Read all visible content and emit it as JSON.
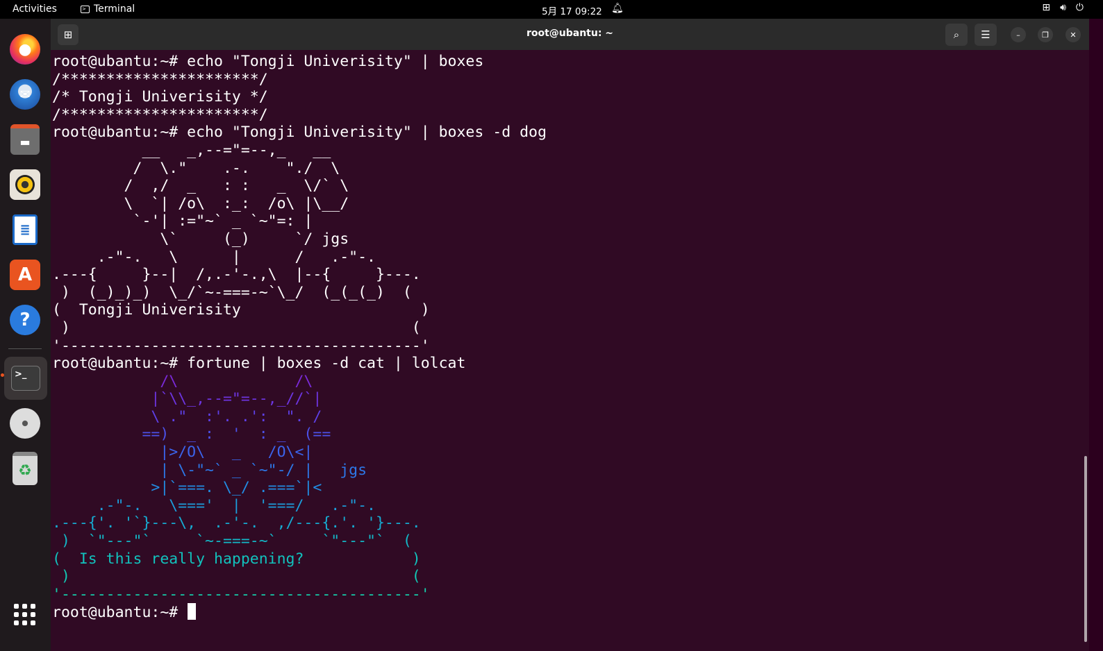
{
  "topbar": {
    "activities": "Activities",
    "app_name": "Terminal",
    "clock": "5月 17  09:22"
  },
  "dock": {
    "items": [
      "firefox-icon",
      "thunderbird-icon",
      "files-icon",
      "rhythmbox-icon",
      "writer-icon",
      "software-icon",
      "help-icon",
      "terminal-icon",
      "disc-icon",
      "trash-icon",
      "show-apps-icon"
    ]
  },
  "window": {
    "title": "root@ubantu: ~"
  },
  "terminal": {
    "lines": [
      "root@ubantu:~# echo \"Tongji Univerisity\" | boxes",
      "/**********************/",
      "/* Tongji Univerisity */",
      "/**********************/",
      "root@ubantu:~# echo \"Tongji Univerisity\" | boxes -d dog",
      "          __   _,--=\"=--,_   __",
      "         /  \\.\"    .-.    \"./  \\",
      "        /  ,/  _   : :   _  \\/` \\",
      "        \\  `| /o\\  :_:  /o\\ |\\__/",
      "         `-'| :=\"~` _ `~\"=: |",
      "            \\`     (_)     `/ jgs",
      "     .-\"-.   \\      |      /   .-\"-.",
      ".---{     }--|  /,.-'-.,\\  |--{     }---.",
      " )  (_)_)_)  \\_/`~-===-~`\\_/  (_(_(_)  (",
      "(  Tongji Univerisity                    )",
      " )                                      (",
      "'----------------------------------------'",
      "root@ubantu:~# fortune | boxes -d cat | lolcat",
      "            /\\             /\\",
      "           |`\\\\_,--=\"=--,_//`|",
      "           \\ .\"  :'. .':  \". /",
      "          ==)  _ :  '  : _  (==",
      "            |>/O\\   _   /O\\<|",
      "            | \\-\"~` _ `~\"-/ |   jgs",
      "           >|`===. \\_/ .===`|<",
      "     .-\"-.   \\==='  |  '===/   .-\"-.",
      ".---{'. '`}---\\,  .-'-.  ,/---{.'. '}---.",
      " )  `\"---\"`     `~-===-~`     `\"---\"`  (",
      "(  Is this really happening?            )",
      " )                                      (",
      "'----------------------------------------'"
    ],
    "prompt": "root@ubantu:~# "
  },
  "colors": {
    "terminal_bg": "#300a24",
    "accent": "#e95420"
  }
}
